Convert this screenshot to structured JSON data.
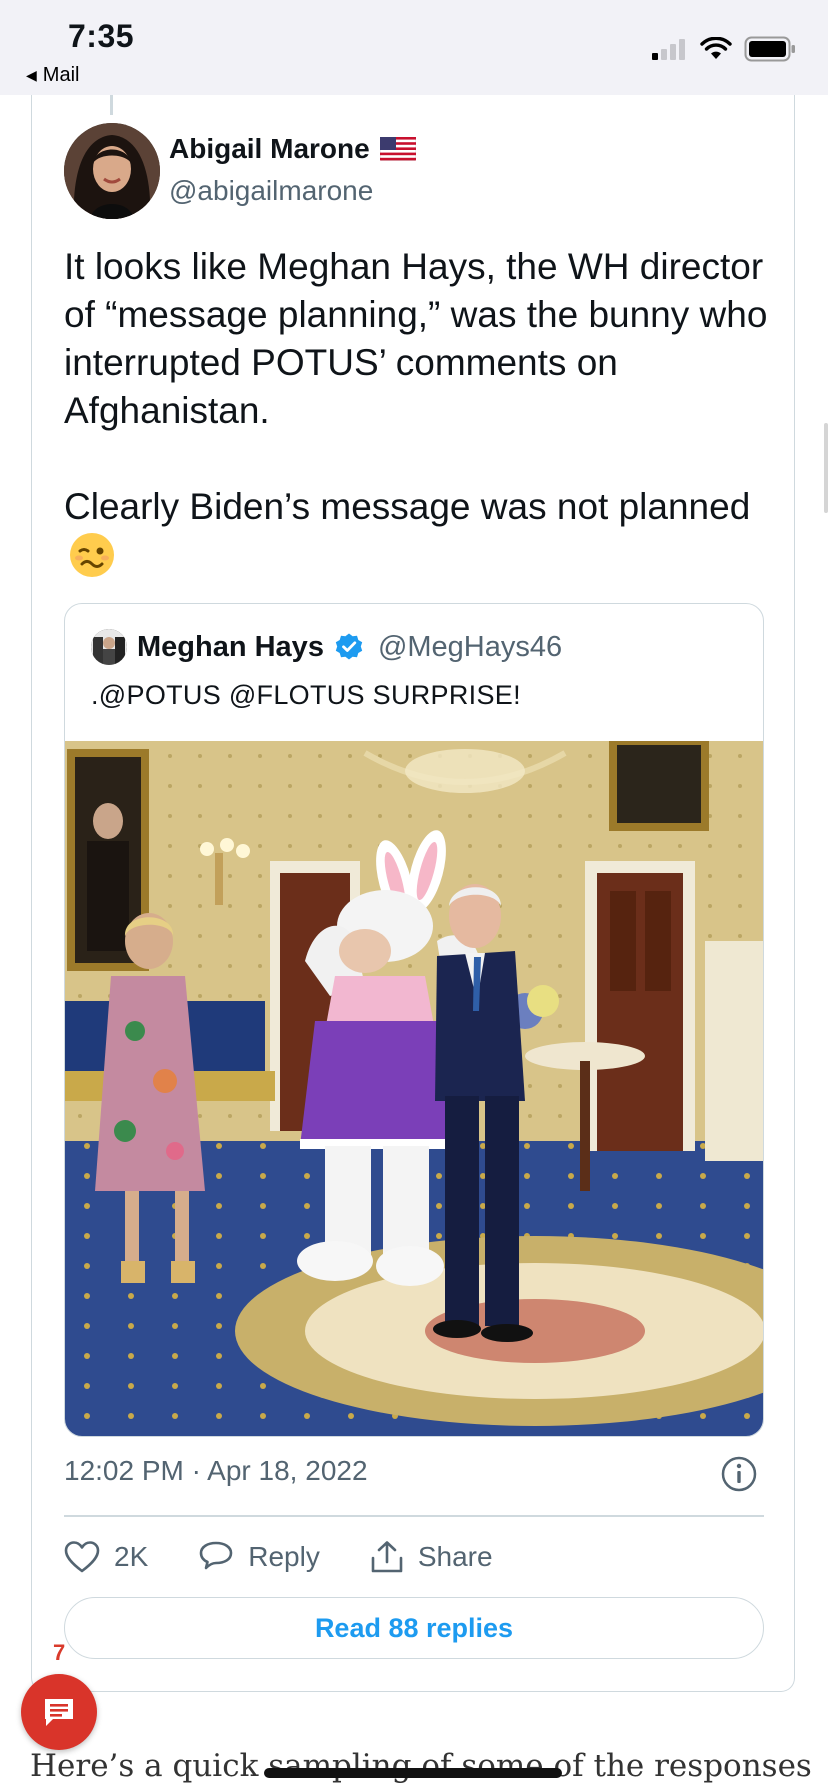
{
  "status_bar": {
    "time": "7:35",
    "back_label": "Mail",
    "icons": [
      "cellular-signal-icon",
      "wifi-icon",
      "battery-icon"
    ]
  },
  "tweet": {
    "author_name": "Abigail Marone",
    "author_flag": "us-flag-icon",
    "author_handle": "@abigailmarone",
    "text": "It looks like Meghan Hays, the WH director of “message planning,” was the bunny who interrupted POTUS’ comments on Afghanistan.\n\nClearly Biden’s message was not planned",
    "text_emoji": "woozy-face-icon",
    "quoted": {
      "name": "Meghan Hays",
      "verified": true,
      "handle": "@MegHays46",
      "text": ".@POTUS @FLOTUS SURPRISE!"
    },
    "timestamp": "12:02 PM · Apr 18, 2022",
    "likes": "2K",
    "reply_label": "Reply",
    "share_label": "Share",
    "read_replies": "Read 88 replies"
  },
  "comments_badge": "7",
  "article_text": "Here’s a quick sampling of some of the responses",
  "colors": {
    "accent_blue": "#1d9bf0",
    "text_secondary": "#536471",
    "border": "#cfd9de",
    "comment_red": "#d9342a"
  }
}
